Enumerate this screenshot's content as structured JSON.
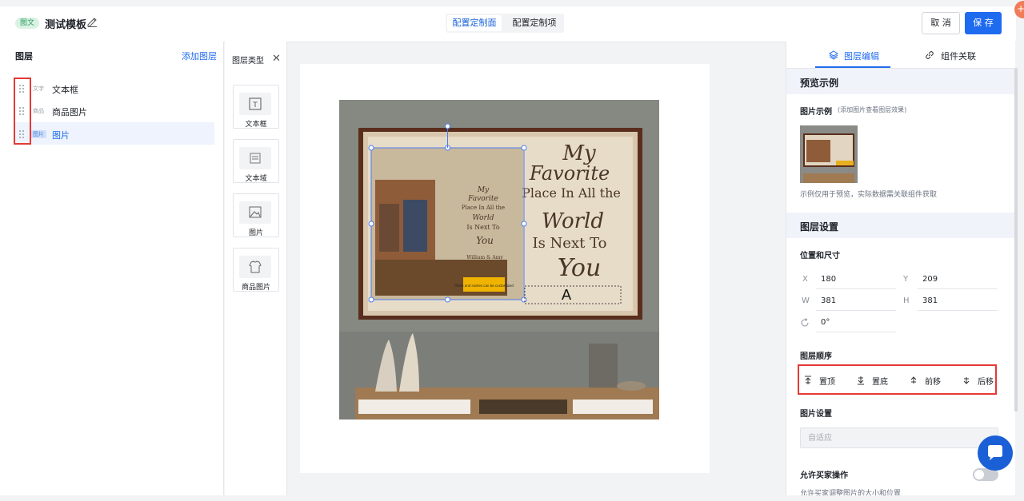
{
  "header": {
    "badge": "图文",
    "title": "测试模板",
    "tabs": [
      "配置定制面",
      "配置定制项"
    ],
    "cancel_label": "取 消",
    "save_label": "保 存"
  },
  "layers_panel": {
    "title": "图层",
    "add_label": "添加图层",
    "items": [
      {
        "tag": "文字",
        "name": "文本框"
      },
      {
        "tag": "商品",
        "name": "商品图片"
      },
      {
        "tag": "图片",
        "name": "图片",
        "selected": true
      }
    ]
  },
  "layer_types": {
    "title": "图层类型",
    "close_icon": "close-icon",
    "items": [
      {
        "label": "文本框",
        "icon": "text-box-icon"
      },
      {
        "label": "文本域",
        "icon": "text-area-icon"
      },
      {
        "label": "图片",
        "icon": "image-icon"
      },
      {
        "label": "商品图片",
        "icon": "tshirt-icon"
      }
    ]
  },
  "canvas": {
    "art_text": [
      "My",
      "Favorite",
      "Place In All the",
      "World",
      "Is Next To",
      "You"
    ],
    "small_text": [
      "My",
      "Favorite",
      "Place In All the",
      "World",
      "Is Next To",
      "You",
      "William & Amy"
    ],
    "yellow_label": "Photo and names can be customized",
    "text_placeholder": "A"
  },
  "right_panel": {
    "tabs": [
      {
        "label": "图层编辑",
        "icon": "layers-icon"
      },
      {
        "label": "组件关联",
        "icon": "link-icon"
      }
    ],
    "preview": {
      "section_title": "预览示例",
      "image_label": "图片示例",
      "image_hint": "(添加图片查看图层效果)",
      "note": "示例仅用于预览，实际数据需关联组件获取"
    },
    "layer_settings": {
      "section_title": "图层设置",
      "pos_size_label": "位置和尺寸",
      "x_label": "X",
      "x": "180",
      "y_label": "Y",
      "y": "209",
      "w_label": "W",
      "w": "381",
      "h_label": "H",
      "h": "381",
      "rotation": "0°",
      "order_label": "图层顺序",
      "order_buttons": [
        "置顶",
        "置底",
        "前移",
        "后移"
      ],
      "image_settings_label": "图片设置",
      "image_mode_placeholder": "自适应",
      "allow_buyer_label": "允许买家操作",
      "allow_buyer_note": "允许买家调整图片的大小和位置"
    }
  },
  "colors": {
    "accent": "#1f6bf0",
    "highlight_box": "#e53935"
  }
}
